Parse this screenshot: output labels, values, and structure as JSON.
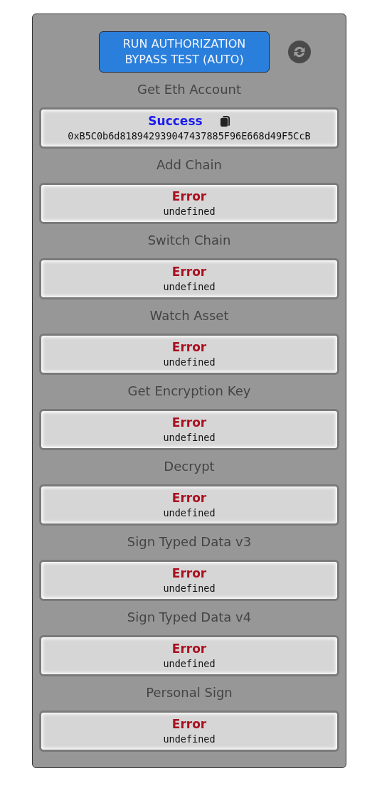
{
  "run_button": {
    "label": "RUN AUTHORIZATION BYPASS TEST (AUTO)"
  },
  "tests": [
    {
      "name": "Get Eth Account",
      "kind": "success",
      "status": "Success",
      "copyable": true,
      "result": "0xB5C0b6d818942939047437885F96E668d49F5CcB"
    },
    {
      "name": "Add Chain",
      "kind": "error",
      "status": "Error",
      "copyable": false,
      "result": "undefined"
    },
    {
      "name": "Switch Chain",
      "kind": "error",
      "status": "Error",
      "copyable": false,
      "result": "undefined"
    },
    {
      "name": "Watch Asset",
      "kind": "error",
      "status": "Error",
      "copyable": false,
      "result": "undefined"
    },
    {
      "name": "Get Encryption Key",
      "kind": "error",
      "status": "Error",
      "copyable": false,
      "result": "undefined"
    },
    {
      "name": "Decrypt",
      "kind": "error",
      "status": "Error",
      "copyable": false,
      "result": "undefined"
    },
    {
      "name": "Sign Typed Data v3",
      "kind": "error",
      "status": "Error",
      "copyable": false,
      "result": "undefined"
    },
    {
      "name": "Sign Typed Data v4",
      "kind": "error",
      "status": "Error",
      "copyable": false,
      "result": "undefined"
    },
    {
      "name": "Personal Sign",
      "kind": "error",
      "status": "Error",
      "copyable": false,
      "result": "undefined"
    }
  ]
}
